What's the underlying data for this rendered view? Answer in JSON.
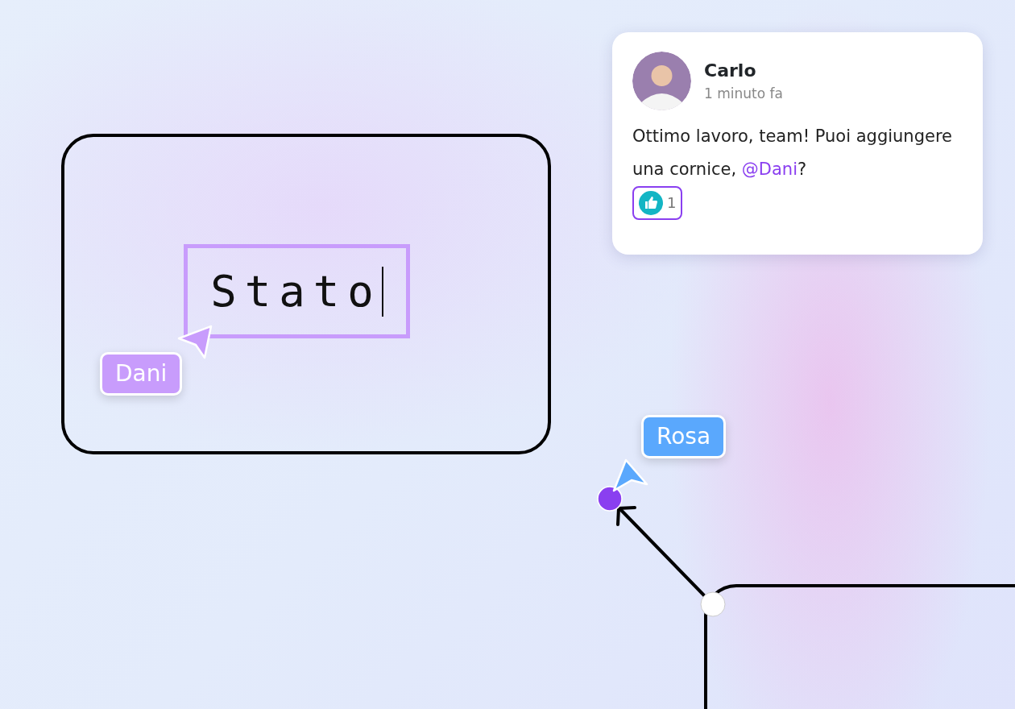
{
  "text_box": {
    "text": "Stato",
    "editing": true
  },
  "cursors": [
    {
      "user": "Dani",
      "color": "#c89cfc"
    },
    {
      "user": "Rosa",
      "color": "#5aa8fd"
    }
  ],
  "comment": {
    "author": "Carlo",
    "time": "1 minuto fa",
    "text": "Ottimo lavoro, team! Puoi aggiungere una cornice, ",
    "mention": "@Dani",
    "text_end": "?",
    "reactions": [
      {
        "count": "1",
        "selected": true
      }
    ]
  }
}
